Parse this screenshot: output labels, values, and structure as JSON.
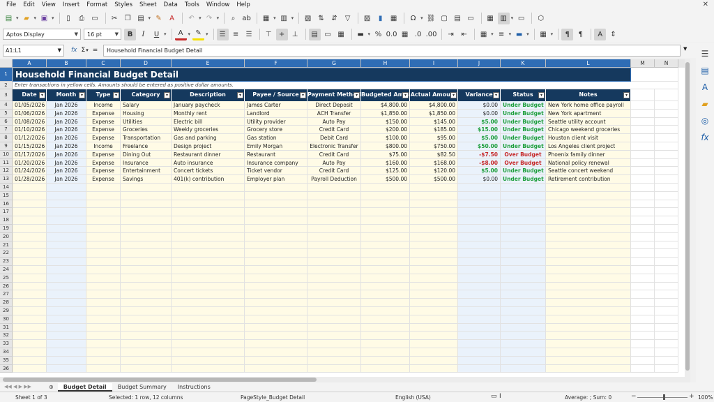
{
  "menu": [
    "File",
    "Edit",
    "View",
    "Insert",
    "Format",
    "Styles",
    "Sheet",
    "Data",
    "Tools",
    "Window",
    "Help"
  ],
  "font_name": "Aptos Display",
  "font_size": "16 pt",
  "name_box": "A1:L1",
  "formula": "Household Financial Budget Detail",
  "columns": [
    "A",
    "B",
    "C",
    "D",
    "E",
    "F",
    "G",
    "H",
    "I",
    "J",
    "K",
    "L",
    "M",
    "N"
  ],
  "title": "Household Financial Budget Detail",
  "instruction": "Enter transactions in yellow cells. Amounts should be entered as positive dollar amounts.",
  "headers": [
    "Date",
    "Month",
    "Type",
    "Category",
    "Description",
    "Payee / Source",
    "Payment Method",
    "Budgeted Amount",
    "Actual Amount",
    "Variance",
    "Status",
    "Notes"
  ],
  "rows": [
    [
      "01/05/2026",
      "Jan 2026",
      "Income",
      "Salary",
      "January paycheck",
      "James Carter",
      "Direct Deposit",
      "$4,800.00",
      "$4,800.00",
      "$0.00",
      "Under Budget",
      "New York home office payroll"
    ],
    [
      "01/06/2026",
      "Jan 2026",
      "Expense",
      "Housing",
      "Monthly rent",
      "Landlord",
      "ACH Transfer",
      "$1,850.00",
      "$1,850.00",
      "$0.00",
      "Under Budget",
      "New York apartment"
    ],
    [
      "01/08/2026",
      "Jan 2026",
      "Expense",
      "Utilities",
      "Electric bill",
      "Utility provider",
      "Auto Pay",
      "$150.00",
      "$145.00",
      "$5.00",
      "Under Budget",
      "Seattle utility account"
    ],
    [
      "01/10/2026",
      "Jan 2026",
      "Expense",
      "Groceries",
      "Weekly groceries",
      "Grocery store",
      "Credit Card",
      "$200.00",
      "$185.00",
      "$15.00",
      "Under Budget",
      "Chicago weekend groceries"
    ],
    [
      "01/12/2026",
      "Jan 2026",
      "Expense",
      "Transportation",
      "Gas and parking",
      "Gas station",
      "Debit Card",
      "$100.00",
      "$95.00",
      "$5.00",
      "Under Budget",
      "Houston client visit"
    ],
    [
      "01/15/2026",
      "Jan 2026",
      "Income",
      "Freelance",
      "Design project",
      "Emily Morgan",
      "Electronic Transfer",
      "$800.00",
      "$750.00",
      "$50.00",
      "Under Budget",
      "Los Angeles client project"
    ],
    [
      "01/17/2026",
      "Jan 2026",
      "Expense",
      "Dining Out",
      "Restaurant dinner",
      "Restaurant",
      "Credit Card",
      "$75.00",
      "$82.50",
      "-$7.50",
      "Over Budget",
      "Phoenix family dinner"
    ],
    [
      "01/20/2026",
      "Jan 2026",
      "Expense",
      "Insurance",
      "Auto insurance",
      "Insurance company",
      "Auto Pay",
      "$160.00",
      "$168.00",
      "-$8.00",
      "Over Budget",
      "National policy renewal"
    ],
    [
      "01/24/2026",
      "Jan 2026",
      "Expense",
      "Entertainment",
      "Concert tickets",
      "Ticket vendor",
      "Credit Card",
      "$125.00",
      "$120.00",
      "$5.00",
      "Under Budget",
      "Seattle concert weekend"
    ],
    [
      "01/28/2026",
      "Jan 2026",
      "Expense",
      "Savings",
      "401(k) contribution",
      "Employer plan",
      "Payroll Deduction",
      "$500.00",
      "$500.00",
      "$0.00",
      "Under Budget",
      "Retirement contribution"
    ]
  ],
  "empty_row_start": 14,
  "empty_row_end": 36,
  "sheet_tabs": [
    "Budget Detail",
    "Budget Summary",
    "Instructions"
  ],
  "active_tab": "Budget Detail",
  "status": {
    "sheet": "Sheet 1 of 3",
    "selection": "Selected: 1 row, 12 columns",
    "page_style": "PageStyle_Budget Detail",
    "language": "English (USA)",
    "sum": "Average: ; Sum: 0",
    "zoom": "100%"
  },
  "colors": {
    "header_bg": "#15395e",
    "accent": "#2f6db5",
    "input_yellow": "#fffbe6",
    "calc_blue": "#eaf2fb",
    "positive": "#1e9e3c",
    "negative": "#c62828"
  }
}
